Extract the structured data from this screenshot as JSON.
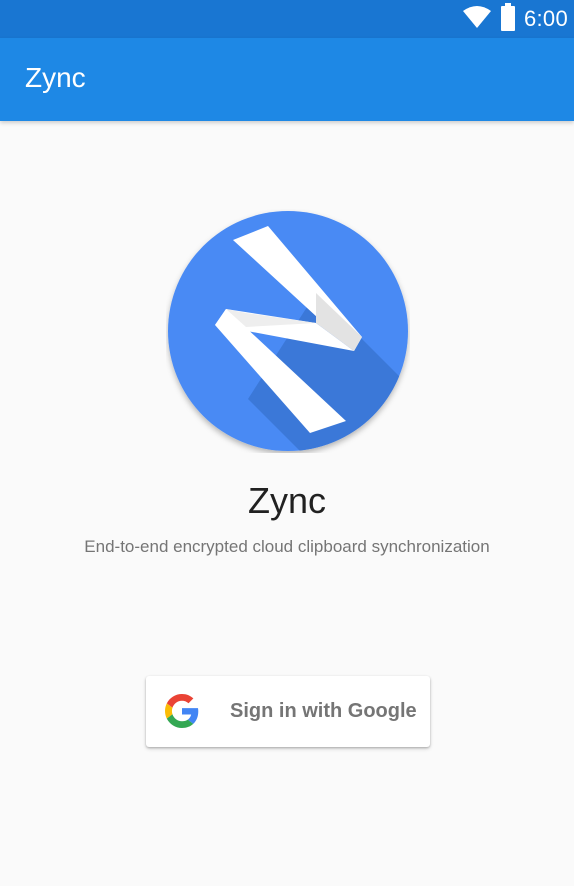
{
  "status_bar": {
    "time": "6:00",
    "icons": [
      "wifi-icon",
      "battery-icon"
    ],
    "background_color": "#1976d2"
  },
  "app_bar": {
    "title": "Zync",
    "background_color": "#1e88e5"
  },
  "hero": {
    "logo": "zync-logo",
    "title": "Zync",
    "subtitle": "End-to-end encrypted cloud clipboard synchronization"
  },
  "sign_in": {
    "icon": "google-g-icon",
    "label": "Sign in with Google"
  },
  "colors": {
    "accent": "#4a8af4",
    "logo_shadow": "#3b78d8",
    "text_primary": "#212121",
    "text_secondary": "#757575",
    "background": "#fafafa"
  }
}
